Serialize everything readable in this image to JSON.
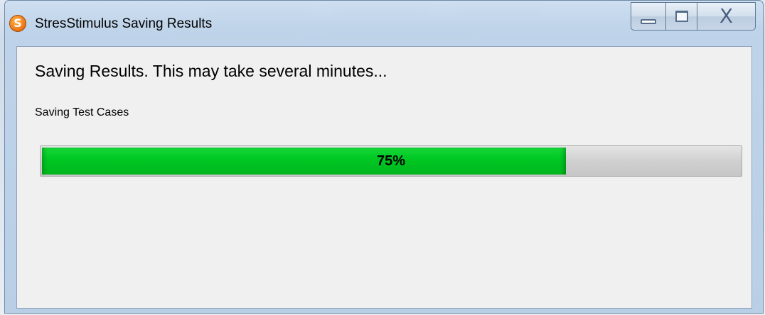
{
  "window": {
    "title": "StresStimulus Saving Results",
    "app_icon_letter": "S",
    "minimize_icon": "minimize-icon",
    "maximize_icon": "maximize-icon",
    "close_icon": "close-icon",
    "close_glyph": "X"
  },
  "dialog": {
    "heading": "Saving Results. This may take several minutes...",
    "status_text": "Saving Test Cases",
    "progress": {
      "value": 75,
      "label": "75%",
      "fill_color": "#00c823",
      "track_color": "#d0d0d0"
    }
  }
}
